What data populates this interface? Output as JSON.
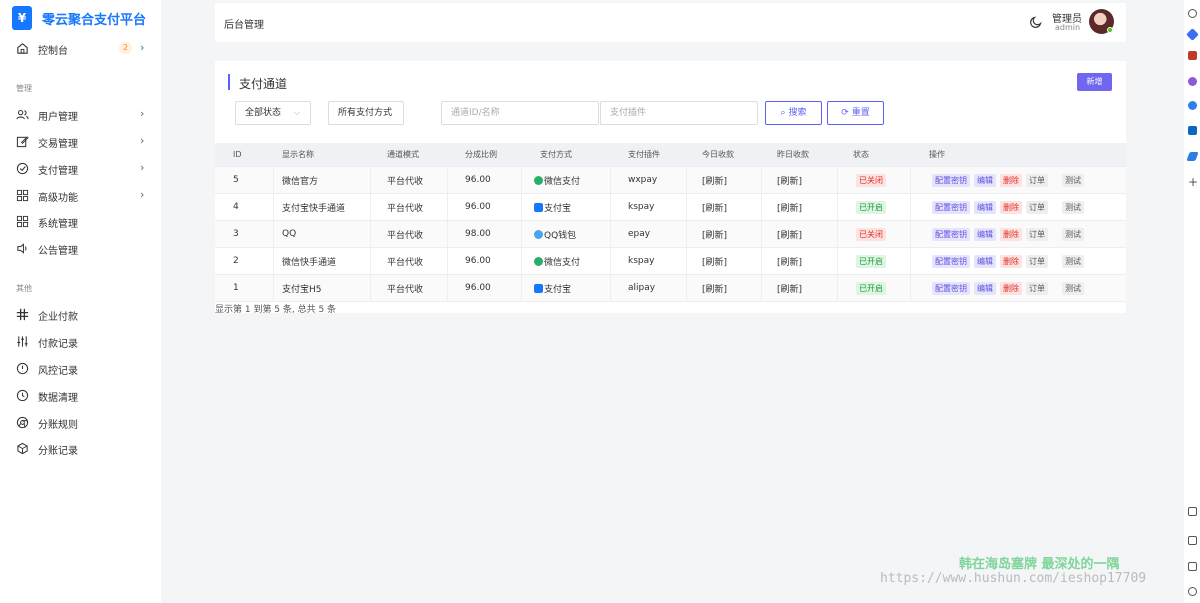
{
  "brand": {
    "logo_glyph": "¥",
    "title": "零云聚合支付平台"
  },
  "sidebar": {
    "dashboard": {
      "label": "控制台",
      "badge": "2"
    },
    "section_manage": "管理",
    "manage_items": [
      {
        "label": "用户管理",
        "icon": "users-icon",
        "has_children": true
      },
      {
        "label": "交易管理",
        "icon": "edit-icon",
        "has_children": true
      },
      {
        "label": "支付管理",
        "icon": "check-circle-icon",
        "has_children": true
      },
      {
        "label": "高级功能",
        "icon": "grid-icon",
        "has_children": true
      },
      {
        "label": "系统管理",
        "icon": "grid-icon",
        "has_children": false
      },
      {
        "label": "公告管理",
        "icon": "speaker-icon",
        "has_children": false
      }
    ],
    "section_other": "其他",
    "other_items": [
      {
        "label": "企业付款",
        "icon": "slack-icon"
      },
      {
        "label": "付款记录",
        "icon": "sliders-icon"
      },
      {
        "label": "风控记录",
        "icon": "alert-circle-icon"
      },
      {
        "label": "数据清理",
        "icon": "clock-icon"
      },
      {
        "label": "分账规则",
        "icon": "chrome-icon"
      },
      {
        "label": "分账记录",
        "icon": "codesandbox-icon"
      }
    ]
  },
  "header": {
    "title": "后台管理",
    "role": "管理员",
    "username": "admin"
  },
  "card": {
    "title": "支付通道",
    "new_button": "新增",
    "filters": {
      "status": "全部状态",
      "method": "所有支付方式",
      "channel_placeholder": "通道ID/名称",
      "plugin_placeholder": "支付插件"
    },
    "search_button": "搜索",
    "reset_button": "重置"
  },
  "table": {
    "columns": [
      "ID",
      "显示名称",
      "通道模式",
      "分成比例",
      "支付方式",
      "支付插件",
      "今日收款",
      "昨日收款",
      "状态",
      "操作"
    ],
    "rows": [
      {
        "id": "5",
        "name": "微信官方",
        "mode": "平台代收",
        "rate": "96.00",
        "pay_icon": "wx",
        "pay": "微信支付",
        "plugin": "wxpay",
        "today": "[刷新]",
        "yesterday": "[刷新]",
        "status": "已关闭",
        "status_type": "off"
      },
      {
        "id": "4",
        "name": "支付宝快手通道",
        "mode": "平台代收",
        "rate": "96.00",
        "pay_icon": "ali",
        "pay": "支付宝",
        "plugin": "kspay",
        "today": "[刷新]",
        "yesterday": "[刷新]",
        "status": "已开启",
        "status_type": "on"
      },
      {
        "id": "3",
        "name": "QQ",
        "mode": "平台代收",
        "rate": "98.00",
        "pay_icon": "qq",
        "pay": "QQ钱包",
        "plugin": "epay",
        "today": "[刷新]",
        "yesterday": "[刷新]",
        "status": "已关闭",
        "status_type": "off"
      },
      {
        "id": "2",
        "name": "微信快手通道",
        "mode": "平台代收",
        "rate": "96.00",
        "pay_icon": "wx",
        "pay": "微信支付",
        "plugin": "kspay",
        "today": "[刷新]",
        "yesterday": "[刷新]",
        "status": "已开启",
        "status_type": "on"
      },
      {
        "id": "1",
        "name": "支付宝H5",
        "mode": "平台代收",
        "rate": "96.00",
        "pay_icon": "ali",
        "pay": "支付宝",
        "plugin": "alipay",
        "today": "[刷新]",
        "yesterday": "[刷新]",
        "status": "已开启",
        "status_type": "on"
      }
    ],
    "actions": {
      "config": "配置密钥",
      "edit": "编辑",
      "delete": "删除",
      "order": "订单",
      "test": "测试"
    },
    "footer": "显示第 1 到第 5 条, 总共 5 条"
  },
  "watermark": {
    "line1": "韩在海岛塞牌 最深处的一隅",
    "line2": "https://www.hushun.com/ieshop17709"
  },
  "colors": {
    "brand": "#1677ff",
    "accent": "#5b61f5",
    "new_button": "#7166f0",
    "status_on": "#1a9a3b",
    "status_off": "#e0302a"
  }
}
